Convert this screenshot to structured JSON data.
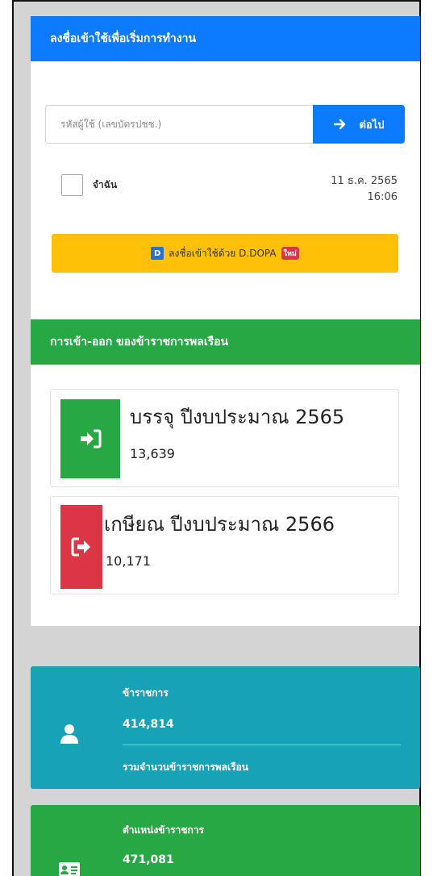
{
  "login": {
    "header": "ลงชื่อเข้าใช้เพื่อเริ่มการทำงาน",
    "input_placeholder": "รหัสผู้ใช้ (เลขบัตรปชช.)",
    "next_label": "ต่อไป",
    "remember_label": "จำฉัน",
    "date": "11 ธ.ค. 2565",
    "time": "16:06",
    "dopa_logo": "D",
    "dopa_label": "ลงชื่อเข้าใช้ด้วย D.DOPA",
    "new_badge": "ใหม่"
  },
  "inout": {
    "header": "การเข้า-ออก ของข้าราชการพลเรือน",
    "entry": {
      "title": "บรรจุ ปีงบประมาณ 2565",
      "value": "13,639",
      "icon": "sign-in-icon"
    },
    "exit": {
      "title": "เกษียณ ปีงบประมาณ 2566",
      "value": "10,171",
      "icon": "sign-out-icon"
    }
  },
  "stats": [
    {
      "label": "ข้าราชการ",
      "value": "414,814",
      "sub": "รวมจำนวนข้าราชการพลเรือน",
      "icon": "user-icon",
      "color": "#17a2b8"
    },
    {
      "label": "ตำแหน่งข้าราชการ",
      "value": "471,081",
      "icon": "id-card-icon",
      "color": "#28a745"
    }
  ],
  "colors": {
    "primary": "#0d7bff",
    "success": "#28a745",
    "danger": "#dc3545",
    "warning": "#ffc107",
    "info": "#17a2b8"
  }
}
